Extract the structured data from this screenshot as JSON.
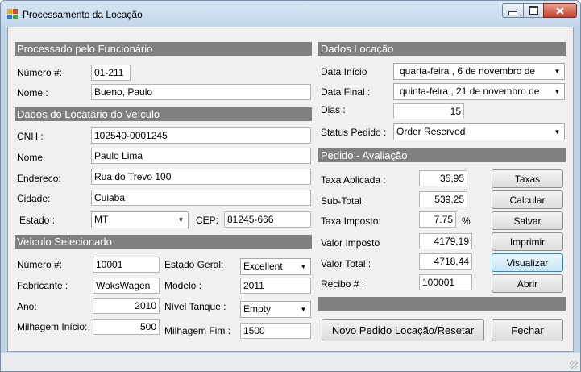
{
  "window": {
    "title": "Processamento da Locação",
    "controls": {
      "minimize": "—",
      "maximize": "☐",
      "close": "✕"
    }
  },
  "funcionario": {
    "header": "Processado pelo Funcionário",
    "numero_label": "Número #:",
    "numero_value": "01-211",
    "nome_label": "Nome :",
    "nome_value": "Bueno, Paulo"
  },
  "locatario": {
    "header": "Dados do Locatário do Veículo",
    "cnh_label": "CNH :",
    "cnh_value": "102540-0001245",
    "nome_label": "Nome",
    "nome_value": "Paulo Lima",
    "endereco_label": "Endereco:",
    "endereco_value": "Rua do Trevo 100",
    "cidade_label": "Cidade:",
    "cidade_value": "Cuiaba",
    "estado_label": "Estado :",
    "estado_value": "MT",
    "cep_label": "CEP:",
    "cep_value": "81245-666"
  },
  "veiculo": {
    "header": "Veículo Selecionado",
    "numero_label": "Número #:",
    "numero_value": "10001",
    "fabricante_label": "Fabricante :",
    "fabricante_value": "WoksWagen",
    "ano_label": "Ano:",
    "ano_value": "2010",
    "milhagem_inicio_label": "Milhagem Início:",
    "milhagem_inicio_value": "500",
    "estado_geral_label": "Estado Geral:",
    "estado_geral_value": "Excellent",
    "modelo_label": "Modelo :",
    "modelo_value": "2011",
    "nivel_tanque_label": "Nível Tanque :",
    "nivel_tanque_value": "Empty",
    "milhagem_fim_label": "Milhagem Fim :",
    "milhagem_fim_value": "1500"
  },
  "locacao": {
    "header": "Dados Locação",
    "data_inicio_label": "Data Início",
    "data_inicio_value": "quarta-feira  ,  6 de novembro de",
    "data_final_label": "Data Final :",
    "data_final_value": "quinta-feira  , 21 de novembro de",
    "dias_label": "Dias :",
    "dias_value": "15",
    "status_label": "Status Pedido :",
    "status_value": "Order Reserved"
  },
  "avaliacao": {
    "header": "Pedido - Avaliação",
    "taxa_aplicada_label": "Taxa Aplicada :",
    "taxa_aplicada_value": "35,95",
    "subtotal_label": "Sub-Total:",
    "subtotal_value": "539,25",
    "taxa_imposto_label": "Taxa Imposto:",
    "taxa_imposto_value": "7.75",
    "percent": "%",
    "valor_imposto_label": "Valor Imposto",
    "valor_imposto_value": "4179,19",
    "valor_total_label": "Valor Total :",
    "valor_total_value": "4718,44",
    "recibo_label": "Recibo # :",
    "recibo_value": "100001"
  },
  "buttons": {
    "taxas": "Taxas",
    "calcular": "Calcular",
    "salvar": "Salvar",
    "imprimir": "Imprimir",
    "visualizar": "Visualizar",
    "abrir": "Abrir",
    "novo_pedido": "Novo Pedido Locação/Resetar",
    "fechar": "Fechar"
  },
  "icons": {
    "dropdown": "chevron-down-icon",
    "app": "app-icon"
  }
}
